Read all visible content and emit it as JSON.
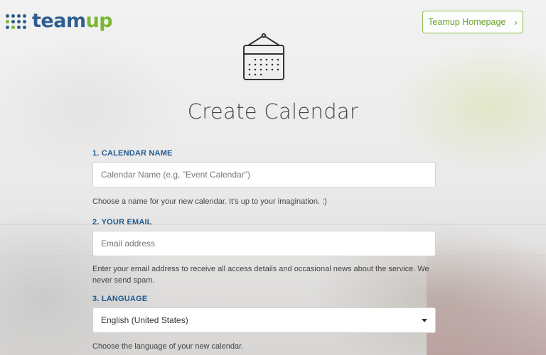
{
  "brand": {
    "logo_part1": "team",
    "logo_part2": "up",
    "dot_colors": [
      "#2f5f8e",
      "#7ab733"
    ]
  },
  "header": {
    "homepage_button_label": "Teamup Homepage",
    "homepage_button_icon": "chevron-right-icon"
  },
  "hero": {
    "icon": "calendar-icon",
    "title": "Create Calendar"
  },
  "form": {
    "calendar_name": {
      "label": "1. CALENDAR NAME",
      "placeholder": "Calendar Name (e.g, \"Event Calendar\")",
      "value": "",
      "help": "Choose a name for your new calendar. It's up to your imagination. :)"
    },
    "email": {
      "label": "2. YOUR EMAIL",
      "placeholder": "Email address",
      "value": "",
      "help": "Enter your email address to receive all access details and occasional news about the service. We never send spam."
    },
    "language": {
      "label": "3. LANGUAGE",
      "selected": "English (United States)",
      "help": "Choose the language of your new calendar."
    }
  },
  "colors": {
    "accent_green": "#7ab733",
    "label_blue": "#1f5a8e"
  }
}
